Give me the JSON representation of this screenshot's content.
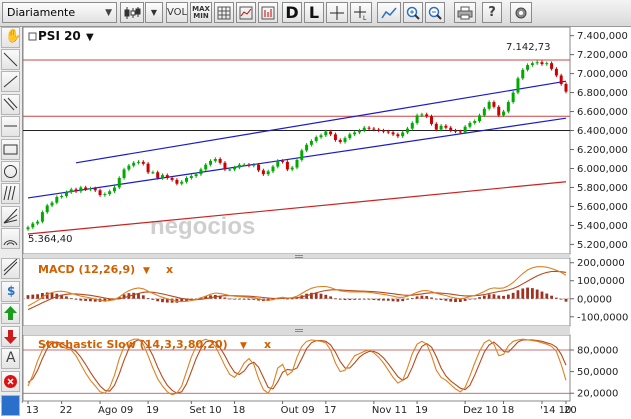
{
  "toolbar": {
    "period_label": "Diariamente",
    "vol_label": "VOL",
    "maxmin_label": [
      "MAX",
      "MIN"
    ],
    "daily_label": "D",
    "line_label": "L"
  },
  "panels": {
    "price_title": "PSI 20",
    "macd_title": "MACD (12,26,9)",
    "stoch_title": "Stochastic Slow (14,3,3,80,20)",
    "close_label": "x",
    "max_label": "7.142,73",
    "min_label": "5.364,40",
    "watermark": "negocios"
  },
  "colors": {
    "up": "#00aa00",
    "down": "#cc0000",
    "channel": "#1a1acc",
    "trend": "#cc2222",
    "macd_line": "#e08020",
    "signal_line": "#b84a1e",
    "hist": "#a03020",
    "title_orange": "#d06000"
  },
  "chart_data": [
    {
      "type": "candlestick",
      "title": "PSI 20",
      "x_ticks": [
        "13",
        "22",
        "Ago 09",
        "19",
        "Set 10",
        "18",
        "Out 09",
        "17",
        "Nov 11",
        "19",
        "Dez 10",
        "18",
        "'14 10",
        "20"
      ],
      "y_ticks": [
        "7.400,000",
        "7.200,000",
        "7.000,000",
        "6.800,000",
        "6.600,000",
        "6.400,000",
        "6.200,000",
        "6.000,000",
        "5.800,000",
        "5.600,000",
        "5.400,000",
        "5.200,000"
      ],
      "y_ticks_values": [
        7400,
        7200,
        7000,
        6800,
        6600,
        6400,
        6200,
        6000,
        5800,
        5600,
        5400,
        5200
      ],
      "ylim": [
        5120,
        7470
      ],
      "max_value": 7142.73,
      "min_value": 5364.4,
      "horizontal_levels": [
        7142.73,
        6550,
        6400
      ],
      "closes": [
        5380,
        5420,
        5440,
        5540,
        5610,
        5640,
        5700,
        5710,
        5750,
        5780,
        5760,
        5800,
        5780,
        5790,
        5770,
        5720,
        5730,
        5760,
        5800,
        5900,
        5990,
        6030,
        6060,
        6070,
        6050,
        5960,
        5960,
        5900,
        5930,
        5900,
        5880,
        5840,
        5860,
        5900,
        5920,
        5940,
        5990,
        6040,
        6080,
        6100,
        6060,
        5990,
        5990,
        6010,
        6040,
        6040,
        6030,
        6040,
        5980,
        5940,
        5970,
        6020,
        6080,
        6070,
        5990,
        6010,
        6090,
        6190,
        6250,
        6290,
        6330,
        6350,
        6390,
        6360,
        6300,
        6280,
        6320,
        6360,
        6380,
        6400,
        6430,
        6420,
        6410,
        6400,
        6390,
        6380,
        6360,
        6340,
        6380,
        6420,
        6480,
        6560,
        6570,
        6550,
        6470,
        6410,
        6450,
        6430,
        6400,
        6390,
        6380,
        6440,
        6480,
        6500,
        6560,
        6630,
        6700,
        6650,
        6560,
        6600,
        6700,
        6800,
        6950,
        7040,
        7090,
        7110,
        7120,
        7100,
        7110,
        7050,
        6980,
        6890,
        6810
      ],
      "support_channel": {
        "start": [
          0,
          5690
        ],
        "end": [
          112,
          6530
        ]
      },
      "resistance_channel": {
        "start": [
          10,
          6060
        ],
        "end": [
          112,
          6920
        ]
      },
      "long_trend": {
        "start": [
          0,
          5310
        ],
        "end": [
          112,
          5860
        ]
      }
    },
    {
      "type": "line",
      "title": "MACD (12,26,9)",
      "y_ticks": [
        "200,0000",
        "100,0000",
        "0,0000",
        "-100,0000"
      ],
      "y_ticks_values": [
        200,
        100,
        0,
        -100
      ],
      "ylim": [
        -140,
        215
      ],
      "macd": [
        -40,
        -25,
        -10,
        10,
        25,
        35,
        40,
        42,
        38,
        30,
        22,
        15,
        10,
        5,
        -2,
        -8,
        -12,
        -10,
        -5,
        10,
        30,
        45,
        55,
        60,
        55,
        42,
        30,
        18,
        8,
        0,
        -8,
        -14,
        -16,
        -14,
        -10,
        -5,
        5,
        15,
        25,
        32,
        30,
        24,
        18,
        14,
        12,
        10,
        8,
        6,
        0,
        -6,
        -8,
        -5,
        4,
        8,
        4,
        6,
        14,
        30,
        45,
        58,
        65,
        68,
        68,
        62,
        52,
        44,
        40,
        38,
        38,
        38,
        38,
        36,
        32,
        28,
        24,
        20,
        14,
        8,
        8,
        14,
        24,
        36,
        44,
        46,
        40,
        30,
        24,
        18,
        10,
        4,
        0,
        4,
        12,
        18,
        28,
        40,
        54,
        60,
        58,
        60,
        72,
        90,
        115,
        140,
        160,
        172,
        178,
        178,
        175,
        168,
        158,
        146,
        130
      ],
      "signal": [
        -60,
        -48,
        -35,
        -22,
        -10,
        2,
        12,
        20,
        25,
        27,
        27,
        25,
        22,
        19,
        14,
        9,
        4,
        0,
        -2,
        0,
        6,
        14,
        22,
        30,
        36,
        38,
        36,
        32,
        27,
        21,
        14,
        8,
        2,
        -2,
        -4,
        -5,
        -3,
        1,
        6,
        11,
        15,
        17,
        17,
        17,
        16,
        15,
        14,
        12,
        10,
        7,
        4,
        2,
        2,
        3,
        3,
        4,
        6,
        11,
        17,
        25,
        33,
        40,
        46,
        49,
        50,
        49,
        47,
        45,
        44,
        43,
        42,
        41,
        39,
        37,
        34,
        31,
        28,
        24,
        21,
        19,
        20,
        23,
        27,
        31,
        33,
        33,
        31,
        29,
        26,
        22,
        18,
        16,
        16,
        17,
        19,
        23,
        29,
        35,
        40,
        44,
        49,
        57,
        68,
        83,
        98,
        113,
        127,
        138,
        146,
        151,
        152,
        150,
        146
      ]
    },
    {
      "type": "line",
      "title": "Stochastic Slow (14,3,3,80,20)",
      "y_ticks": [
        "80,0000",
        "50,0000",
        "20,0000"
      ],
      "y_ticks_values": [
        80,
        50,
        20
      ],
      "ylim": [
        12,
        98
      ],
      "levels": [
        80,
        20
      ],
      "k": [
        30,
        45,
        65,
        80,
        90,
        92,
        90,
        85,
        82,
        80,
        72,
        60,
        48,
        38,
        30,
        22,
        20,
        28,
        45,
        68,
        85,
        92,
        95,
        95,
        88,
        72,
        55,
        40,
        30,
        22,
        18,
        20,
        30,
        50,
        70,
        85,
        92,
        95,
        92,
        85,
        72,
        58,
        46,
        42,
        50,
        62,
        68,
        60,
        40,
        25,
        20,
        32,
        55,
        60,
        45,
        50,
        70,
        85,
        92,
        94,
        93,
        92,
        90,
        80,
        62,
        50,
        52,
        62,
        72,
        75,
        78,
        80,
        76,
        70,
        62,
        52,
        42,
        34,
        38,
        55,
        75,
        88,
        92,
        88,
        72,
        52,
        42,
        38,
        32,
        26,
        22,
        28,
        44,
        62,
        78,
        90,
        94,
        88,
        72,
        74,
        86,
        92,
        94,
        95,
        94,
        93,
        92,
        90,
        88,
        85,
        78,
        60,
        38
      ],
      "d": [
        35,
        40,
        52,
        68,
        82,
        90,
        91,
        89,
        85,
        82,
        78,
        70,
        60,
        49,
        39,
        30,
        24,
        23,
        31,
        47,
        66,
        82,
        91,
        94,
        93,
        85,
        72,
        56,
        42,
        31,
        24,
        20,
        22,
        33,
        50,
        68,
        82,
        91,
        93,
        91,
        83,
        72,
        59,
        49,
        46,
        51,
        60,
        63,
        56,
        42,
        28,
        26,
        36,
        49,
        53,
        52,
        55,
        68,
        82,
        90,
        93,
        93,
        92,
        87,
        77,
        64,
        55,
        55,
        62,
        70,
        75,
        78,
        78,
        75,
        69,
        61,
        52,
        43,
        38,
        42,
        56,
        73,
        85,
        89,
        84,
        71,
        55,
        44,
        37,
        32,
        27,
        25,
        31,
        45,
        61,
        77,
        87,
        91,
        85,
        78,
        77,
        84,
        91,
        94,
        94,
        94,
        93,
        92,
        90,
        88,
        84,
        74,
        59
      ]
    }
  ]
}
